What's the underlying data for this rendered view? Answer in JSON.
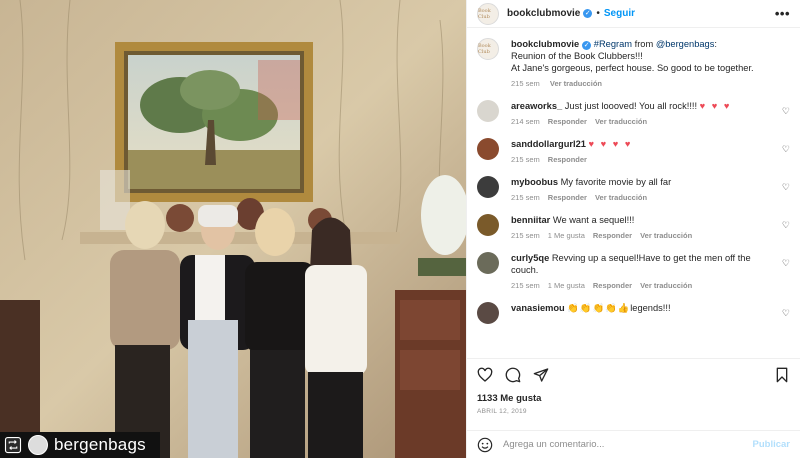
{
  "photo": {
    "repost_handle": "bergenbags"
  },
  "header": {
    "username": "bookclubmovie",
    "verified": "✓",
    "dot": "•",
    "follow_label": "Seguir",
    "more": "•••",
    "avatar_text": "Book Club"
  },
  "caption": {
    "username": "bookclubmovie",
    "regram": "#Regram",
    "from_text": " from ",
    "mention": "@bergenbags",
    "line1_tail": ":",
    "line2": "Reunion of the Book Clubbers!!!",
    "line3": "At Jane's gorgeous, perfect house. So good to be together.",
    "time": "215 sem",
    "translate": "Ver traducción"
  },
  "comments": [
    {
      "username": "areaworks_",
      "text": "Just just loooved! You all rock!!!!",
      "emoji": "♥ ♥ ♥",
      "time": "214 sem",
      "likes": "",
      "reply": "Responder",
      "translate": "Ver traducción",
      "avatar_color": "#d9d6cf"
    },
    {
      "username": "sanddollargurl21",
      "text": "",
      "emoji": "♥ ♥ ♥ ♥",
      "time": "215 sem",
      "likes": "",
      "reply": "Responder",
      "translate": "",
      "avatar_color": "#8a4a2e"
    },
    {
      "username": "myboobus",
      "text": "My favorite movie by all far",
      "emoji": "",
      "time": "215 sem",
      "likes": "",
      "reply": "Responder",
      "translate": "Ver traducción",
      "avatar_color": "#3c3c3c"
    },
    {
      "username": "benniitar",
      "text": "We want a sequel!!!",
      "emoji": "",
      "time": "215 sem",
      "likes": "1 Me gusta",
      "reply": "Responder",
      "translate": "Ver traducción",
      "avatar_color": "#7a5a2a"
    },
    {
      "username": "curly5qe",
      "text": "Revving up a sequel!Have to get the men off the couch.",
      "emoji": "",
      "time": "215 sem",
      "likes": "1 Me gusta",
      "reply": "Responder",
      "translate": "Ver traducción",
      "avatar_color": "#6b6b5a"
    },
    {
      "username": "vanasiemou",
      "text": "legends!!!",
      "emoji": "👏👏👏👏👍",
      "time": "",
      "likes": "",
      "reply": "",
      "translate": "",
      "avatar_color": "#5a4a44"
    }
  ],
  "actions": {
    "likes": "1133 Me gusta",
    "date": "ABRIL 12, 2019"
  },
  "comment_box": {
    "placeholder": "Agrega un comentario...",
    "post_label": "Publicar"
  }
}
